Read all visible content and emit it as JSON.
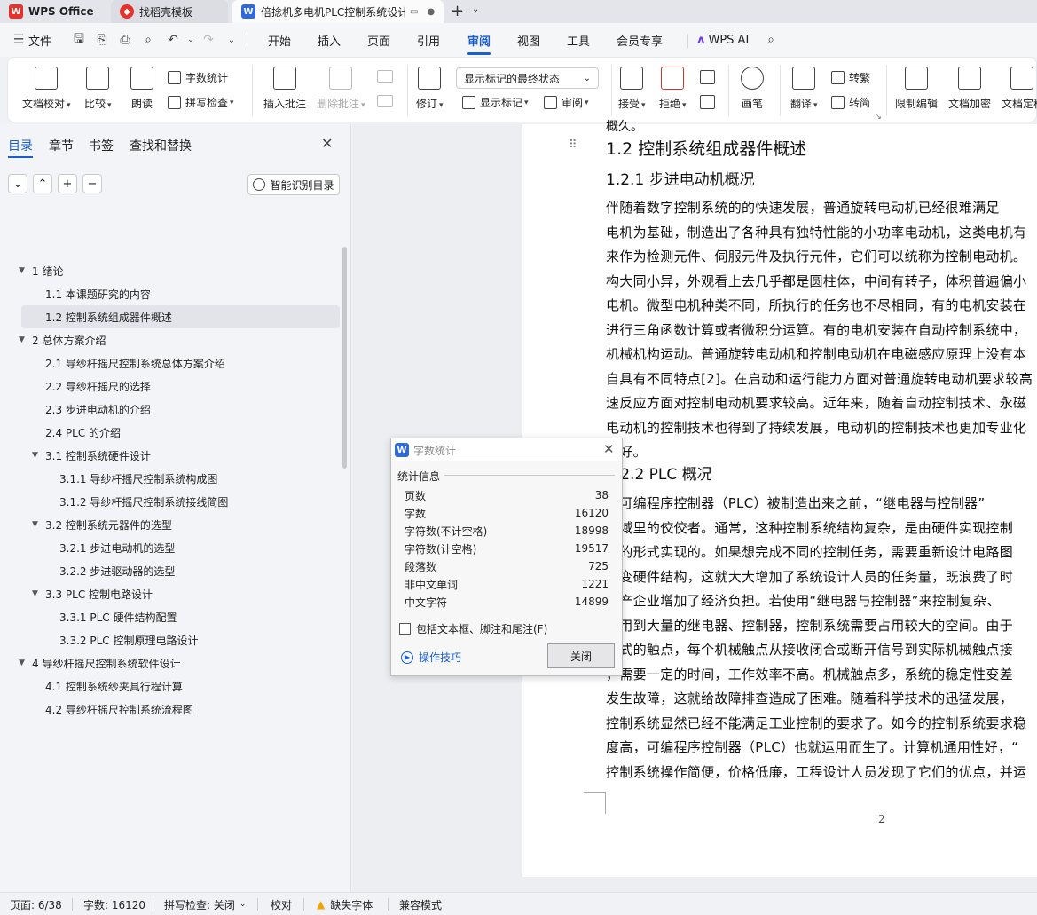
{
  "tabs": [
    {
      "label": "WPS Office",
      "icon": "wps-logo-icon"
    },
    {
      "label": "找稻壳模板",
      "icon": "docer-icon"
    },
    {
      "label": "倍捻机多电机PLC控制系统设计",
      "icon": "writer-icon"
    }
  ],
  "menubar": {
    "file": "文件",
    "items": [
      "开始",
      "插入",
      "页面",
      "引用",
      "审阅",
      "视图",
      "工具",
      "会员专享"
    ],
    "selected": "审阅",
    "ai": "WPS AI"
  },
  "ribbon": {
    "doc_check": "文档校对",
    "compare": "比较",
    "read_aloud": "朗读",
    "word_count": "字数统计",
    "spell_check": "拼写检查",
    "insert_comment": "插入批注",
    "delete_comment": "删除批注",
    "track": "修订",
    "markup_state": "显示标记的最终状态",
    "show_markup": "显示标记",
    "review": "审阅",
    "accept": "接受",
    "reject": "拒绝",
    "pen": "画笔",
    "translate": "翻译",
    "to_traditional": "转繁",
    "to_simplified": "转简",
    "restrict_edit": "限制编辑",
    "encrypt": "文档加密",
    "finalize": "文档定稿"
  },
  "nav": {
    "tabs": [
      "目录",
      "章节",
      "书签",
      "查找和替换"
    ],
    "smart_toc": "智能识别目录",
    "toc": [
      {
        "text": "1 绪论",
        "level": 0,
        "expanded": true
      },
      {
        "text": "1.1 本课题研究的内容",
        "level": 1
      },
      {
        "text": "1.2 控制系统组成器件概述",
        "level": 1,
        "current": true
      },
      {
        "text": "2  总体方案介绍",
        "level": 0,
        "expanded": true
      },
      {
        "text": "2.1 导纱杆摇尺控制系统总体方案介绍",
        "level": 1
      },
      {
        "text": "2.2 导纱杆摇尺的选择",
        "level": 1
      },
      {
        "text": "2.3 步进电动机的介绍",
        "level": 1
      },
      {
        "text": "2.4 PLC 的介绍",
        "level": 1
      },
      {
        "text": "3.1  控制系统硬件设计",
        "level": 1,
        "expanded": true
      },
      {
        "text": "3.1.1 导纱杆摇尺控制系统构成图",
        "level": 2
      },
      {
        "text": "3.1.2 导纱杆摇尺控制系统接线简图",
        "level": 2
      },
      {
        "text": "3.2  控制系统元器件的选型",
        "level": 1,
        "expanded": true
      },
      {
        "text": "3.2.1 步进电动机的选型",
        "level": 2
      },
      {
        "text": "3.2.2  步进驱动器的选型",
        "level": 2
      },
      {
        "text": "3.3 PLC 控制电路设计",
        "level": 1,
        "expanded": true
      },
      {
        "text": "3.3.1 PLC 硬件结构配置",
        "level": 2
      },
      {
        "text": "3.3.2 PLC 控制原理电路设计",
        "level": 2
      },
      {
        "text": "4  导纱杆摇尺控制系统软件设计",
        "level": 0,
        "expanded": true
      },
      {
        "text": "4.1  控制系统纱夹具行程计算",
        "level": 1
      },
      {
        "text": "4.2 导纱杆摇尺控制系统流程图",
        "level": 1
      }
    ]
  },
  "document": {
    "top_fragment": "概久。",
    "h2": "1.2 控制系统组成器件概述",
    "h3": "1.2.1 步进电动机概况",
    "para1": [
      "    伴随着数字控制系统的的快速发展，普通旋转电动机已经很难满足",
      "电机为基础，制造出了各种具有独特性能的小功率电动机，这类电机有",
      "来作为检测元件、伺服元件及执行元件，它们可以统称为控制电动机。",
      "构大同小异，外观看上去几乎都是圆柱体，中间有转子，体积普遍偏小",
      "电机。微型电机种类不同，所执行的任务也不尽相同，有的电机安装在",
      "进行三角函数计算或者微积分运算。有的电机安装在自动控制系统中，",
      "机械机构运动。普通旋转电动机和控制电动机在电磁感应原理上没有本",
      "自具有不同特点[2]。在启动和运行能力方面对普通旋转电动机要求较高",
      "速反应方面对控制电动机要求较高。近年来，随着自动控制技术、永磁",
      "电动机的控制技术也得到了持续发展，电动机的控制技术也更加专业化",
      "更好。"
    ],
    "h3b": "1.2.2 PLC 概况",
    "para2": [
      "    在可编程序控制器（PLC）被制造出来之前，“继电器与控制器”",
      "领域里的佼佼者。通常，这种控制系统结构复杂，是由硬件实现控制",
      "线的形式实现的。如果想完成不同的控制任务，需要重新设计电路图",
      "改变硬件结构，这就大大增加了系统设计人员的任务量，既浪费了时",
      "生产企业增加了经济负担。若使用“继电器与控制器”来控制复杂、",
      "要用到大量的继电器、控制器，控制系统需要占用较大的空间。由于",
      "械式的触点，每个机械触点从接收闭合或断开信号到实际机械触点接",
      "，需要一定的时间，工作效率不高。机械触点多，系统的稳定性变差",
      "发生故障，这就给故障排查造成了困难。随着科学技术的迅猛发展，",
      "控制系统显然已经不能满足工业控制的要求了。如今的控制系统要求稳",
      "度高，可编程序控制器（PLC）也就运用而生了。计算机通用性好，“",
      "控制系统操作简便，价格低廉，工程设计人员发现了它们的优点，并运"
    ],
    "page_number": "2"
  },
  "dialog": {
    "title": "字数统计",
    "section": "统计信息",
    "stats": [
      {
        "label": "页数",
        "value": "38"
      },
      {
        "label": "字数",
        "value": "16120"
      },
      {
        "label": "字符数(不计空格)",
        "value": "18998"
      },
      {
        "label": "字符数(计空格)",
        "value": "19517"
      },
      {
        "label": "段落数",
        "value": "725"
      },
      {
        "label": "非中文单词",
        "value": "1221"
      },
      {
        "label": "中文字符",
        "value": "14899"
      }
    ],
    "checkbox": "包括文本框、脚注和尾注(F)",
    "tips": "操作技巧",
    "close": "关闭"
  },
  "status": {
    "page": "页面: 6/38",
    "words": "字数: 16120",
    "spell": "拼写检查: 关闭",
    "proof": "校对",
    "missing_font": "缺失字体",
    "compat": "兼容模式"
  },
  "colors": {
    "accent": "#1a5fd0",
    "wps_red": "#e8312c",
    "warning": "#f0a500"
  }
}
